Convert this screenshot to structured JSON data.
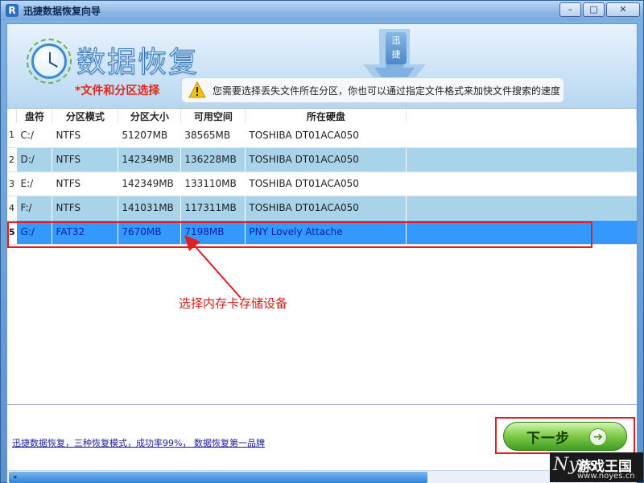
{
  "window": {
    "title": "迅捷数据恢复向导",
    "app_icon": "R",
    "controls": {
      "minimize": "–",
      "maximize": "□",
      "close": "✕"
    }
  },
  "header": {
    "title": "数据恢复",
    "step_label": "*文件和分区选择",
    "tip_text": "您需要选择丢失文件所在分区，你也可以通过指定文件格式来加快文件搜索的速度",
    "logo_text_1": "迅",
    "logo_text_2": "捷"
  },
  "table": {
    "columns": [
      "盘符",
      "分区模式",
      "分区大小",
      "可用空间",
      "所在硬盘"
    ],
    "rows": [
      {
        "index": "1",
        "drive": "C:/",
        "mode": "NTFS",
        "size": "51207MB",
        "free": "38565MB",
        "disk": "TOSHIBA DT01ACA050"
      },
      {
        "index": "2",
        "drive": "D:/",
        "mode": "NTFS",
        "size": "142349MB",
        "free": "136228MB",
        "disk": "TOSHIBA DT01ACA050"
      },
      {
        "index": "3",
        "drive": "E:/",
        "mode": "NTFS",
        "size": "142349MB",
        "free": "133110MB",
        "disk": "TOSHIBA DT01ACA050"
      },
      {
        "index": "4",
        "drive": "F:/",
        "mode": "NTFS",
        "size": "141031MB",
        "free": "117311MB",
        "disk": "TOSHIBA DT01ACA050"
      },
      {
        "index": "5",
        "drive": "G:/",
        "mode": "FAT32",
        "size": "7670MB",
        "free": "7198MB",
        "disk": "PNY Lovely Attache"
      }
    ],
    "selected_row": 5
  },
  "annotation": {
    "text": "选择内存卡存储设备",
    "color": "#d81c1c"
  },
  "footer": {
    "link_text": "迅捷数据恢复，三种恢复模式，成功率99%， 数据恢复第一品牌",
    "next_label": "下一步",
    "next_icon": "arrow-right-icon"
  },
  "watermark": {
    "logo": "Nyes",
    "title": "游戏王国",
    "url": "www.noyes.cn"
  },
  "colors": {
    "selection": "#3399ff",
    "alt_row": "#a9d3e8",
    "accent_red": "#e4261a",
    "next_button": "#84cd4d"
  }
}
